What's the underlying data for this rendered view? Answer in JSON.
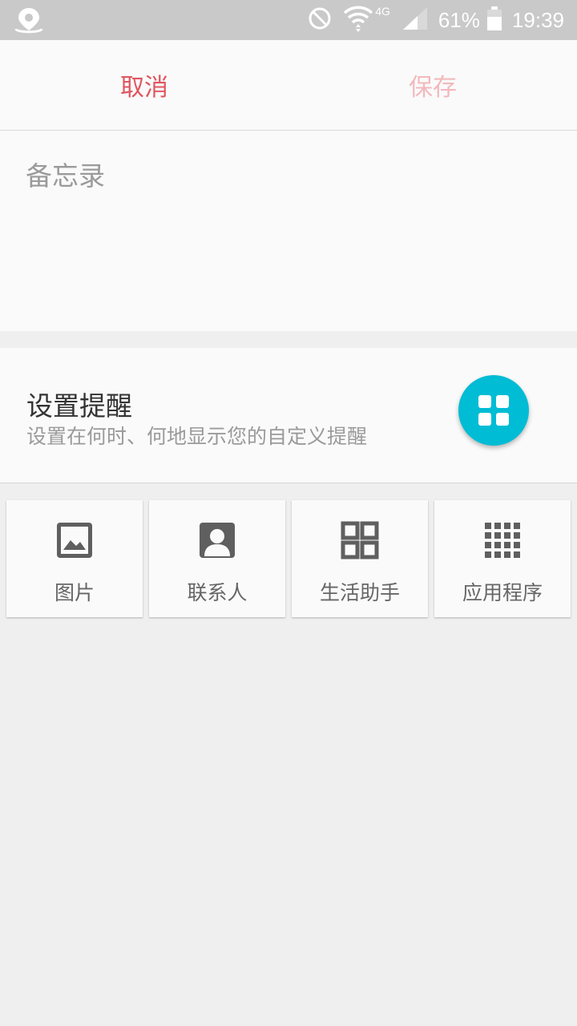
{
  "status_bar": {
    "battery": "61%",
    "time": "19:39",
    "network": "4G",
    "icons": [
      "location-icon",
      "dnd-icon",
      "wifi-icon",
      "signal-icon",
      "battery-icon"
    ]
  },
  "toolbar": {
    "cancel_label": "取消",
    "save_label": "保存",
    "cancel_color": "#e0565f",
    "save_color": "#f2b9bd"
  },
  "memo": {
    "placeholder": "备忘录",
    "value": ""
  },
  "reminder": {
    "title": "设置提醒",
    "subtitle": "设置在何时、何地显示您的自定义提醒",
    "fab_icon": "grid-icon",
    "fab_color": "#00bcd4"
  },
  "attachments": [
    {
      "label": "图片",
      "icon": "image-icon"
    },
    {
      "label": "联系人",
      "icon": "contact-icon"
    },
    {
      "label": "生活助手",
      "icon": "life-assistant-icon"
    },
    {
      "label": "应用程序",
      "icon": "apps-icon"
    }
  ]
}
